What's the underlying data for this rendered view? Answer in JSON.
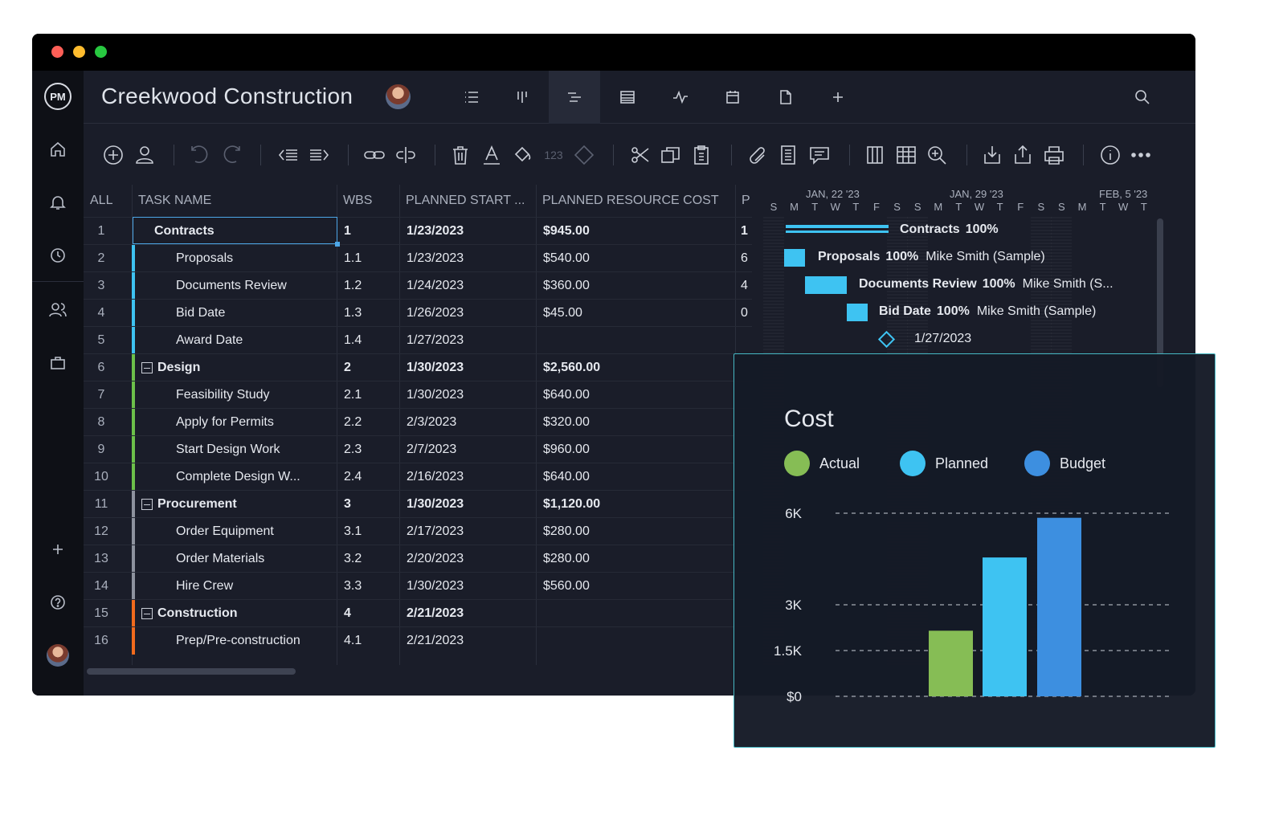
{
  "window": {
    "project_title": "Creekwood Construction"
  },
  "rail": {
    "logo": "PM",
    "items": [
      "home-icon",
      "notifications-icon",
      "recent-icon",
      "people-icon",
      "portfolio-icon",
      "add-icon",
      "help-icon",
      "user-avatar"
    ]
  },
  "view_tabs": [
    "list-view-icon",
    "board-view-icon",
    "gantt-view-icon",
    "sheet-view-icon",
    "dashboard-view-icon",
    "calendar-view-icon",
    "document-view-icon",
    "add-view-icon"
  ],
  "toolbar": {
    "number_format_label": "123"
  },
  "grid": {
    "headers": {
      "all": "ALL",
      "task_name": "TASK NAME",
      "wbs": "WBS",
      "planned_start": "PLANNED START ...",
      "planned_resource_cost": "PLANNED RESOURCE COST",
      "p": "P"
    },
    "rows": [
      {
        "num": "1",
        "name": "Contracts",
        "wbs": "1",
        "start": "1/23/2023",
        "cost": "$945.00",
        "p": "1",
        "color": "#3ec3f2",
        "level": 0,
        "bold": true,
        "group": false
      },
      {
        "num": "2",
        "name": "Proposals",
        "wbs": "1.1",
        "start": "1/23/2023",
        "cost": "$540.00",
        "p": "6",
        "color": "#3ec3f2",
        "level": 1,
        "bold": false,
        "group": false
      },
      {
        "num": "3",
        "name": "Documents Review",
        "wbs": "1.2",
        "start": "1/24/2023",
        "cost": "$360.00",
        "p": "4",
        "color": "#3ec3f2",
        "level": 1,
        "bold": false,
        "group": false
      },
      {
        "num": "4",
        "name": "Bid Date",
        "wbs": "1.3",
        "start": "1/26/2023",
        "cost": "$45.00",
        "p": "0",
        "color": "#3ec3f2",
        "level": 1,
        "bold": false,
        "group": false
      },
      {
        "num": "5",
        "name": "Award Date",
        "wbs": "1.4",
        "start": "1/27/2023",
        "cost": "",
        "p": "",
        "color": "#3ec3f2",
        "level": 1,
        "bold": false,
        "group": false
      },
      {
        "num": "6",
        "name": "Design",
        "wbs": "2",
        "start": "1/30/2023",
        "cost": "$2,560.00",
        "p": "",
        "color": "#6cc04a",
        "level": 0,
        "bold": true,
        "group": true
      },
      {
        "num": "7",
        "name": "Feasibility Study",
        "wbs": "2.1",
        "start": "1/30/2023",
        "cost": "$640.00",
        "p": "",
        "color": "#6cc04a",
        "level": 1,
        "bold": false,
        "group": false
      },
      {
        "num": "8",
        "name": "Apply for Permits",
        "wbs": "2.2",
        "start": "2/3/2023",
        "cost": "$320.00",
        "p": "",
        "color": "#6cc04a",
        "level": 1,
        "bold": false,
        "group": false
      },
      {
        "num": "9",
        "name": "Start Design Work",
        "wbs": "2.3",
        "start": "2/7/2023",
        "cost": "$960.00",
        "p": "",
        "color": "#6cc04a",
        "level": 1,
        "bold": false,
        "group": false
      },
      {
        "num": "10",
        "name": "Complete Design W...",
        "wbs": "2.4",
        "start": "2/16/2023",
        "cost": "$640.00",
        "p": "",
        "color": "#6cc04a",
        "level": 1,
        "bold": false,
        "group": false
      },
      {
        "num": "11",
        "name": "Procurement",
        "wbs": "3",
        "start": "1/30/2023",
        "cost": "$1,120.00",
        "p": "",
        "color": "#8d929e",
        "level": 0,
        "bold": true,
        "group": true
      },
      {
        "num": "12",
        "name": "Order Equipment",
        "wbs": "3.1",
        "start": "2/17/2023",
        "cost": "$280.00",
        "p": "",
        "color": "#8d929e",
        "level": 1,
        "bold": false,
        "group": false
      },
      {
        "num": "13",
        "name": "Order Materials",
        "wbs": "3.2",
        "start": "2/20/2023",
        "cost": "$280.00",
        "p": "",
        "color": "#8d929e",
        "level": 1,
        "bold": false,
        "group": false
      },
      {
        "num": "14",
        "name": "Hire Crew",
        "wbs": "3.3",
        "start": "1/30/2023",
        "cost": "$560.00",
        "p": "",
        "color": "#8d929e",
        "level": 1,
        "bold": false,
        "group": false
      },
      {
        "num": "15",
        "name": "Construction",
        "wbs": "4",
        "start": "2/21/2023",
        "cost": "",
        "p": "",
        "color": "#f26b1d",
        "level": 0,
        "bold": true,
        "group": true
      },
      {
        "num": "16",
        "name": "Prep/Pre-construction",
        "wbs": "4.1",
        "start": "2/21/2023",
        "cost": "",
        "p": "",
        "color": "#f26b1d",
        "level": 1,
        "bold": false,
        "group": false
      }
    ]
  },
  "gantt": {
    "months": [
      "JAN, 22 '23",
      "JAN, 29 '23",
      "FEB, 5 '23"
    ],
    "days": [
      "S",
      "M",
      "T",
      "W",
      "T",
      "F",
      "S",
      "S",
      "M",
      "T",
      "W",
      "T",
      "F",
      "S",
      "S",
      "M",
      "T",
      "W",
      "T"
    ],
    "bars": [
      {
        "name": "Contracts",
        "percent": "100%",
        "assignee": ""
      },
      {
        "name": "Proposals",
        "percent": "100%",
        "assignee": "Mike Smith (Sample)"
      },
      {
        "name": "Documents Review",
        "percent": "100%",
        "assignee": "Mike Smith (S..."
      },
      {
        "name": "Bid Date",
        "percent": "100%",
        "assignee": "Mike Smith (Sample)"
      }
    ],
    "milestone_label": "1/27/2023"
  },
  "cost_widget": {
    "title": "Cost",
    "legend": [
      {
        "name": "Actual",
        "color": "#86bd55"
      },
      {
        "name": "Planned",
        "color": "#3ec3f2"
      },
      {
        "name": "Budget",
        "color": "#3d8fe0"
      }
    ]
  },
  "chart_data": {
    "type": "bar",
    "title": "Cost",
    "categories": [
      "Actual",
      "Planned",
      "Budget"
    ],
    "values": [
      2150,
      4550,
      5850
    ],
    "colors": [
      "#86bd55",
      "#3ec3f2",
      "#3d8fe0"
    ],
    "y_ticks": [
      {
        "value": 0,
        "label": "$0"
      },
      {
        "value": 1500,
        "label": "1.5K"
      },
      {
        "value": 3000,
        "label": "3K"
      },
      {
        "value": 6000,
        "label": "6K"
      }
    ],
    "ylim": [
      0,
      6000
    ],
    "grid": true,
    "legend": "top-left"
  }
}
